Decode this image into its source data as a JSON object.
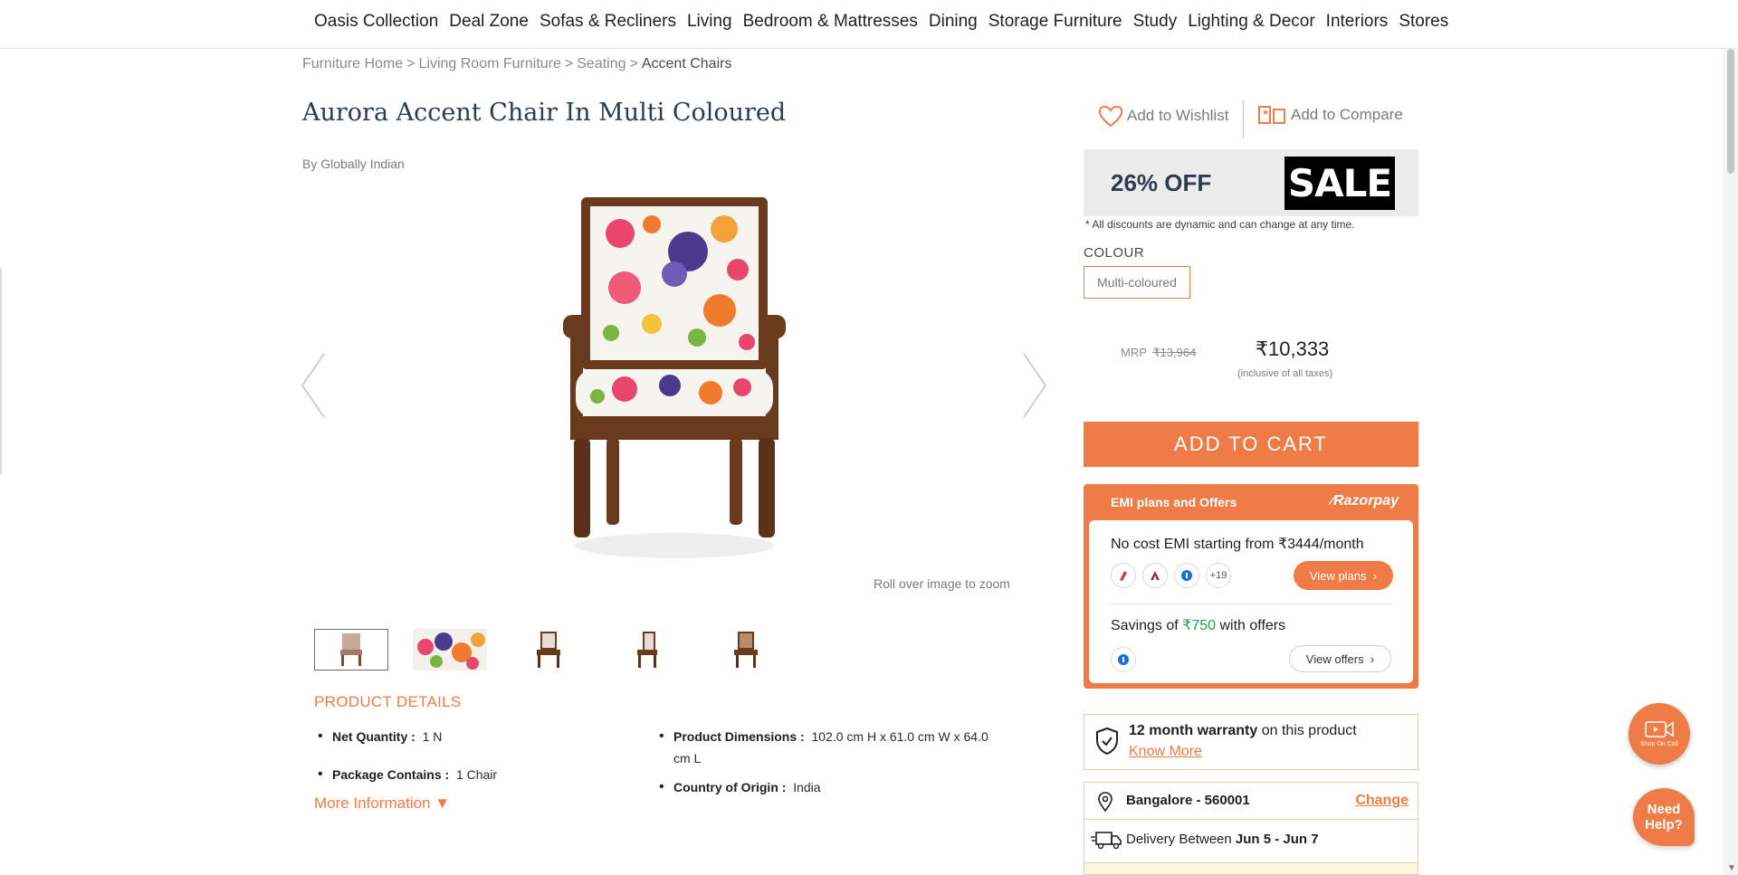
{
  "nav": {
    "items": [
      "Oasis Collection",
      "Deal Zone",
      "Sofas & Recliners",
      "Living",
      "Bedroom & Mattresses",
      "Dining",
      "Storage Furniture",
      "Study",
      "Lighting & Decor",
      "Interiors",
      "Stores"
    ]
  },
  "breadcrumb": {
    "items": [
      "Furniture Home",
      "Living Room Furniture",
      "Seating"
    ],
    "separator": ">",
    "current": "Accent Chairs"
  },
  "product": {
    "title": "Aurora Accent Chair In Multi Coloured",
    "brand": "By Globally Indian",
    "zoom_hint": "Roll over image to zoom"
  },
  "details": {
    "heading": "PRODUCT DETAILS",
    "net_quantity_label": "Net Quantity :",
    "net_quantity": "1 N",
    "package_label": "Package Contains :",
    "package": "1 Chair",
    "dimensions_label": "Product Dimensions :",
    "dimensions": "102.0 cm H x 61.0 cm W x 64.0 cm L",
    "origin_label": "Country of Origin :",
    "origin": "India",
    "more_info": "More Information"
  },
  "actions": {
    "wishlist": "Add to Wishlist",
    "compare": "Add to Compare"
  },
  "offer": {
    "discount": "26% OFF",
    "badge": "SALE",
    "note": "* All discounts are dynamic and can change at any time."
  },
  "colour": {
    "label": "COLOUR",
    "selected": "Multi-coloured"
  },
  "pricing": {
    "mrp_label": "MRP",
    "mrp": "₹13,964",
    "price": "₹10,333",
    "tax_note": "(inclusive of all taxes)"
  },
  "cart": {
    "label": "ADD TO CART"
  },
  "emi": {
    "heading": "EMI plans and Offers",
    "provider": "Razorpay",
    "no_cost_text": "No cost EMI starting from ₹3444/month",
    "more_banks": "+19",
    "view_plans": "View plans",
    "savings_prefix": "Savings of",
    "savings_amount": "₹750",
    "savings_suffix": "with offers",
    "view_offers": "View offers"
  },
  "warranty": {
    "bold": "12 month warranty",
    "rest": "on this product",
    "link": "Know More"
  },
  "location": {
    "place": "Bangalore - 560001",
    "change": "Change"
  },
  "delivery": {
    "prefix": "Delivery Between",
    "range": "Jun 5 - Jun 7"
  },
  "floating": {
    "shop_on_call": "Shop On Call",
    "need_help": "Need Help?"
  },
  "colors": {
    "accent": "#ef7c46",
    "title": "#2e3b4e",
    "green": "#21a34a"
  }
}
